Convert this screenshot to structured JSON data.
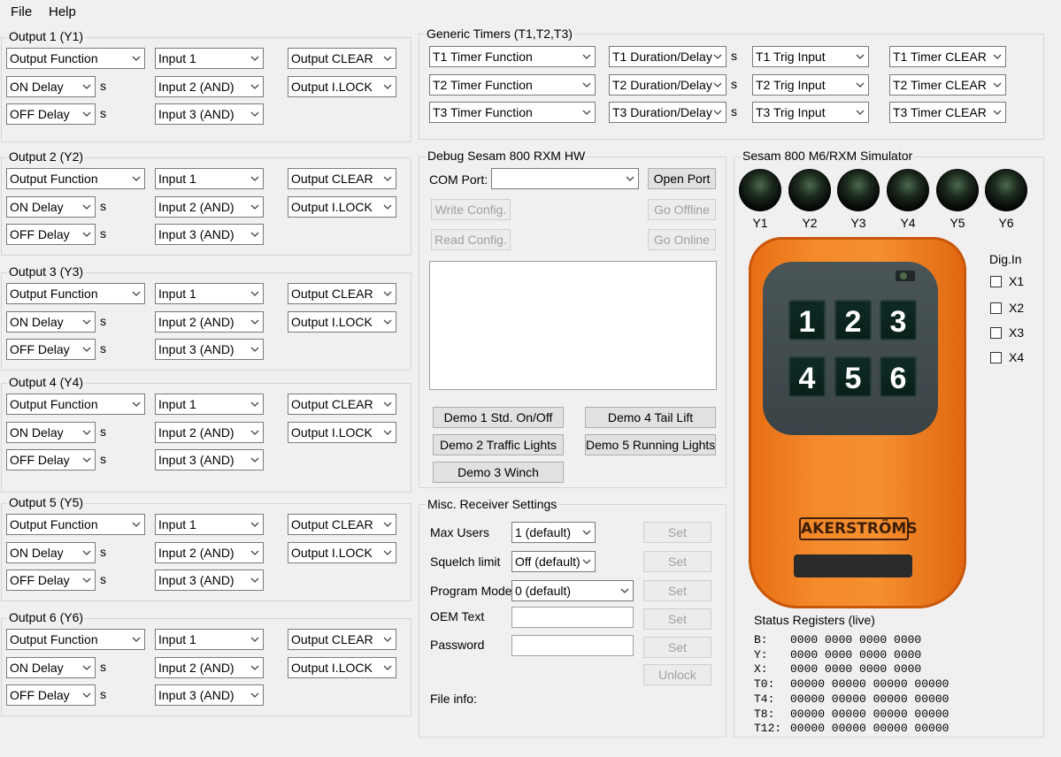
{
  "menu": {
    "file": "File",
    "help": "Help"
  },
  "outputs": [
    {
      "title": "Output 1 (Y1)",
      "function": "Output Function",
      "on_delay": "ON Delay",
      "off_delay": "OFF Delay",
      "input1": "Input 1",
      "input2": "Input 2 (AND)",
      "input3": "Input 3 (AND)",
      "clear": "Output CLEAR",
      "lock": "Output I.LOCK",
      "unit": "s"
    },
    {
      "title": "Output 2 (Y2)",
      "function": "Output Function",
      "on_delay": "ON Delay",
      "off_delay": "OFF Delay",
      "input1": "Input 1",
      "input2": "Input 2 (AND)",
      "input3": "Input 3 (AND)",
      "clear": "Output CLEAR",
      "lock": "Output I.LOCK",
      "unit": "s"
    },
    {
      "title": "Output 3 (Y3)",
      "function": "Output Function",
      "on_delay": "ON Delay",
      "off_delay": "OFF Delay",
      "input1": "Input 1",
      "input2": "Input 2 (AND)",
      "input3": "Input 3 (AND)",
      "clear": "Output CLEAR",
      "lock": "Output I.LOCK",
      "unit": "s"
    },
    {
      "title": "Output 4 (Y4)",
      "function": "Output Function",
      "on_delay": "ON Delay",
      "off_delay": "OFF Delay",
      "input1": "Input 1",
      "input2": "Input 2 (AND)",
      "input3": "Input 3 (AND)",
      "clear": "Output CLEAR",
      "lock": "Output I.LOCK",
      "unit": "s"
    },
    {
      "title": "Output 5 (Y5)",
      "function": "Output Function",
      "on_delay": "ON Delay",
      "off_delay": "OFF Delay",
      "input1": "Input 1",
      "input2": "Input 2 (AND)",
      "input3": "Input 3 (AND)",
      "clear": "Output CLEAR",
      "lock": "Output I.LOCK",
      "unit": "s"
    },
    {
      "title": "Output 6 (Y6)",
      "function": "Output Function",
      "on_delay": "ON Delay",
      "off_delay": "OFF Delay",
      "input1": "Input 1",
      "input2": "Input 2 (AND)",
      "input3": "Input 3 (AND)",
      "clear": "Output CLEAR",
      "lock": "Output I.LOCK",
      "unit": "s"
    }
  ],
  "timers": {
    "title": "Generic Timers (T1,T2,T3)",
    "rows": [
      {
        "function": "T1 Timer Function",
        "duration": "T1 Duration/Delay",
        "unit": "s",
        "trig": "T1 Trig Input",
        "clear": "T1 Timer CLEAR"
      },
      {
        "function": "T2 Timer Function",
        "duration": "T2 Duration/Delay",
        "unit": "s",
        "trig": "T2 Trig Input",
        "clear": "T2 Timer CLEAR"
      },
      {
        "function": "T3 Timer Function",
        "duration": "T3 Duration/Delay",
        "unit": "s",
        "trig": "T3 Trig Input",
        "clear": "T3 Timer CLEAR"
      }
    ]
  },
  "debug": {
    "title": "Debug Sesam 800 RXM HW",
    "com_label": "COM Port:",
    "com_value": "",
    "open_port": "Open Port",
    "write_config": "Write Config.",
    "go_offline": "Go Offline",
    "read_config": "Read Config.",
    "go_online": "Go Online",
    "demo1": "Demo 1 Std. On/Off",
    "demo2": "Demo 2 Traffic Lights",
    "demo3": "Demo 3 Winch",
    "demo4": "Demo 4 Tail Lift",
    "demo5": "Demo 5 Running Lights"
  },
  "misc": {
    "title": "Misc. Receiver Settings",
    "max_users_label": "Max Users",
    "max_users_value": "1 (default)",
    "squelch_label": "Squelch limit",
    "squelch_value": "Off (default)",
    "program_label": "Program Mode",
    "program_value": "0 (default)",
    "oem_label": "OEM Text",
    "password_label": "Password",
    "set": "Set",
    "unlock": "Unlock",
    "file_info": "File info:"
  },
  "simulator": {
    "title": "Sesam 800 M6/RXM Simulator",
    "leds": [
      "Y1",
      "Y2",
      "Y3",
      "Y4",
      "Y5",
      "Y6"
    ],
    "keys": [
      "1",
      "2",
      "3",
      "4",
      "5",
      "6"
    ],
    "logo": "AKERSTRÖMS",
    "dig_in_title": "Dig.In",
    "dig_in": [
      "X1",
      "X2",
      "X3",
      "X4"
    ],
    "status_title": "Status Registers (live)",
    "registers": [
      {
        "label": "B:",
        "value": "0000 0000 0000 0000"
      },
      {
        "label": "Y:",
        "value": "0000 0000 0000 0000"
      },
      {
        "label": "X:",
        "value": "0000 0000 0000 0000"
      },
      {
        "label": "T0:",
        "value": "00000 00000 00000 00000"
      },
      {
        "label": "T4:",
        "value": "00000 00000 00000 00000"
      },
      {
        "label": "T8:",
        "value": "00000 00000 00000 00000"
      },
      {
        "label": "T12:",
        "value": "00000 00000 00000 00000"
      }
    ]
  }
}
